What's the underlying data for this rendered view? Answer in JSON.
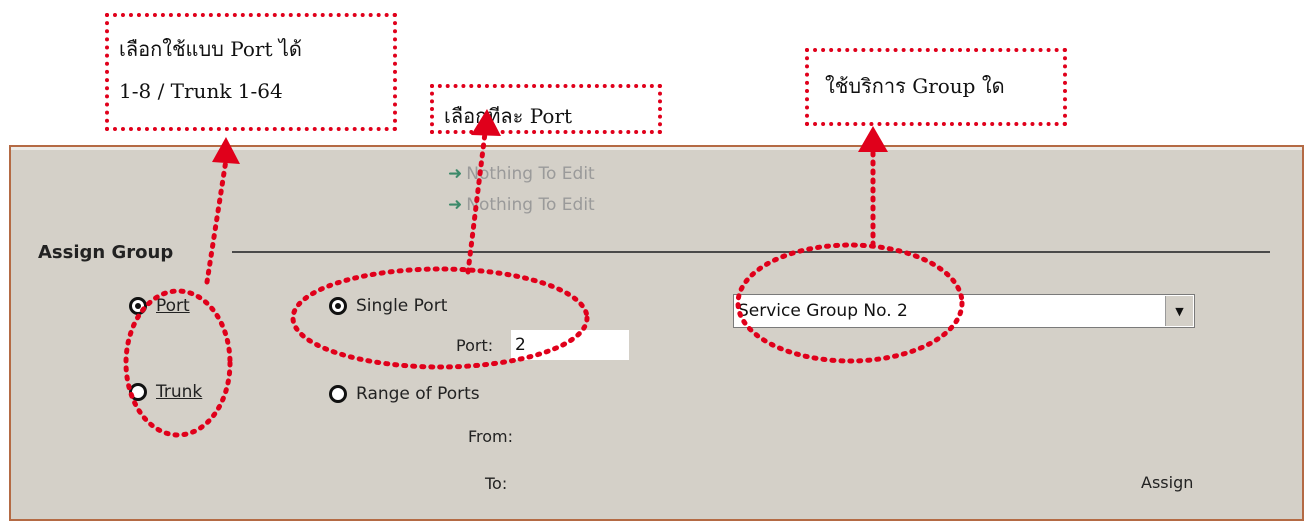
{
  "annotations": {
    "mode_note_line1": "เลือกใช้แบบ Port ได้",
    "mode_note_line2": "1-8  / Trunk 1-64",
    "port_note": "เลือกทีละ Port",
    "group_note": "ใช้บริการ Group ใด"
  },
  "messages": [
    "Nothing To Edit",
    "Nothing To Edit"
  ],
  "section": {
    "title": "Assign Group"
  },
  "mode_options": [
    {
      "label": "Port",
      "selected": true
    },
    {
      "label": "Trunk",
      "selected": false
    }
  ],
  "port_options": [
    {
      "label": "Single Port",
      "selected": true
    },
    {
      "label": "Range of Ports",
      "selected": false
    }
  ],
  "fields": {
    "port_label": "Port:",
    "port_value": "2",
    "from_label": "From:",
    "to_label": "To:"
  },
  "service_group": {
    "selected": "Service Group No. 2"
  },
  "assign_label": "Assign",
  "colors": {
    "annotation": "#e0001b",
    "panel": "#d4d0c8",
    "arrow": "#3c8a6a"
  }
}
